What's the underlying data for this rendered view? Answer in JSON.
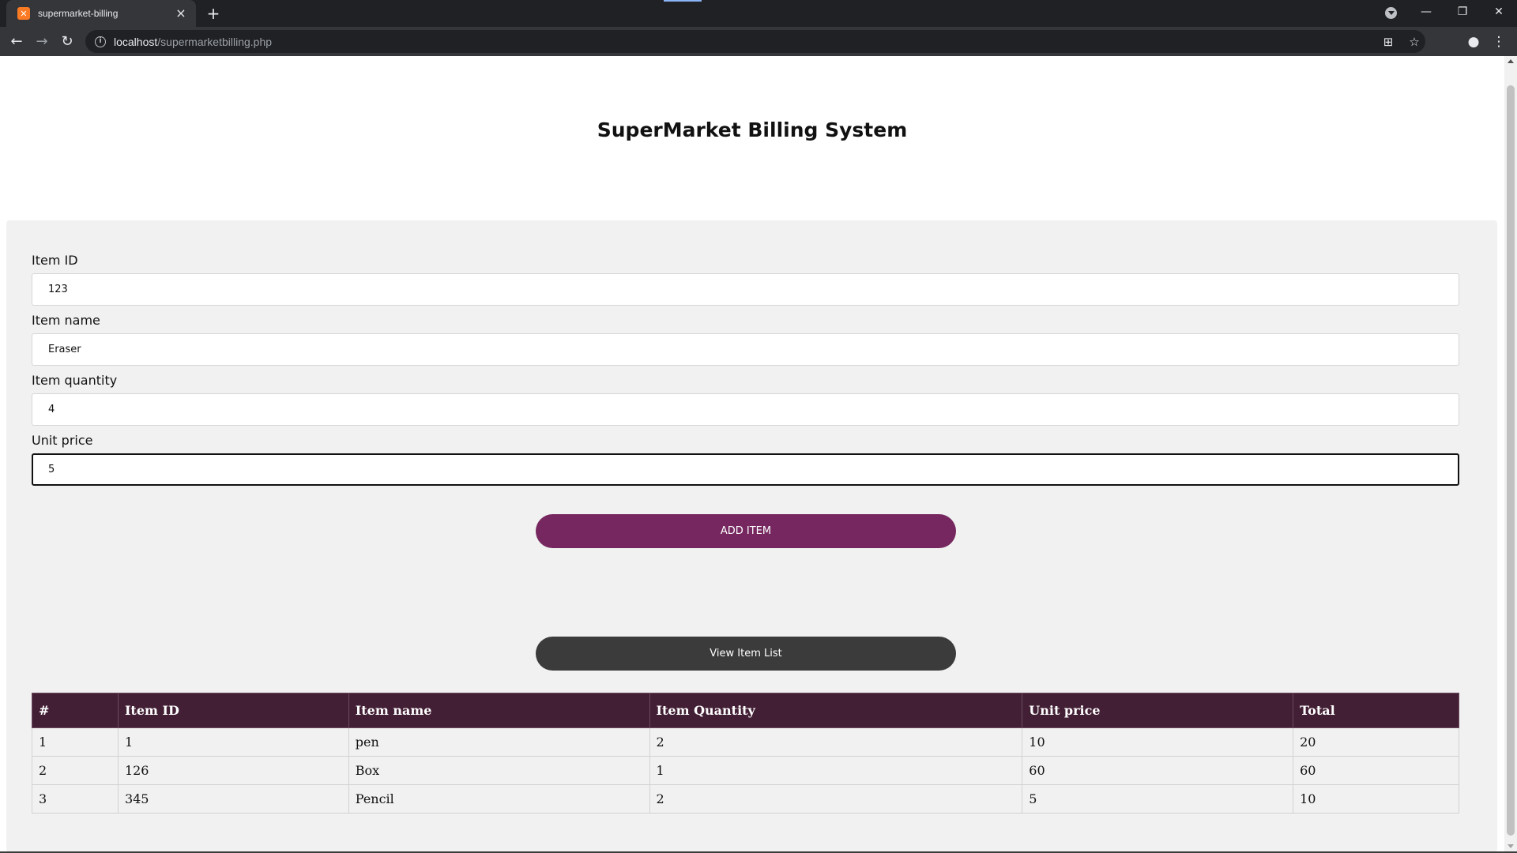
{
  "browser": {
    "tab_title": "supermarket-billing",
    "url_host": "localhost",
    "url_path": "/supermarketbilling.php"
  },
  "page": {
    "title": "SuperMarket Billing System"
  },
  "form": {
    "item_id": {
      "label": "Item ID",
      "value": "123"
    },
    "item_name": {
      "label": "Item name",
      "value": "Eraser"
    },
    "item_quantity": {
      "label": "Item quantity",
      "value": "4"
    },
    "unit_price": {
      "label": "Unit price",
      "value": "5"
    },
    "add_button": "ADD ITEM",
    "view_button": "View Item List"
  },
  "table": {
    "headers": [
      "#",
      "Item ID",
      "Item name",
      "Item Quantity",
      "Unit price",
      "Total"
    ],
    "rows": [
      [
        "1",
        "1",
        "pen",
        "2",
        "10",
        "20"
      ],
      [
        "2",
        "126",
        "Box",
        "1",
        "60",
        "60"
      ],
      [
        "3",
        "345",
        "Pencil",
        "2",
        "5",
        "10"
      ]
    ]
  },
  "colors": {
    "add_button": "#76275f",
    "view_button": "#3b3b3b",
    "table_header": "#431f35"
  }
}
